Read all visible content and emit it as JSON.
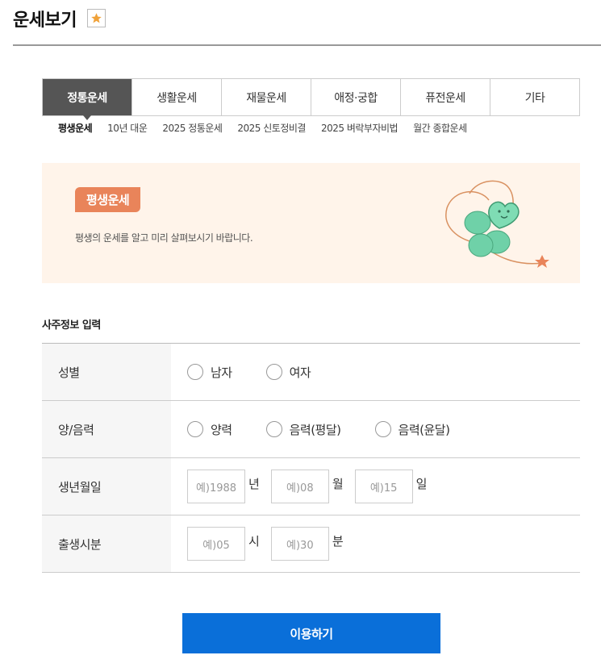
{
  "header": {
    "title": "운세보기",
    "favorite_icon": "star-icon",
    "star_color": "#f0a23a"
  },
  "tabs": [
    {
      "label": "정통운세",
      "active": true
    },
    {
      "label": "생활운세",
      "active": false
    },
    {
      "label": "재물운세",
      "active": false
    },
    {
      "label": "애정·궁합",
      "active": false
    },
    {
      "label": "퓨전운세",
      "active": false
    },
    {
      "label": "기타",
      "active": false
    }
  ],
  "subtabs": [
    {
      "label": "평생운세",
      "active": true
    },
    {
      "label": "10년 대운",
      "active": false
    },
    {
      "label": "2025 정통운세",
      "active": false
    },
    {
      "label": "2025 신토정비결",
      "active": false
    },
    {
      "label": "2025 벼락부자비법",
      "active": false
    },
    {
      "label": "월간 종합운세",
      "active": false
    }
  ],
  "banner": {
    "badge": "평생운세",
    "description": "평생의 운세를 알고 미리 살펴보시기 바랍니다.",
    "illustration": "clover-heart-icon",
    "badge_color": "#e9845a",
    "background_color": "#fff4ea"
  },
  "form": {
    "section_title": "사주정보 입력",
    "gender": {
      "label": "성별",
      "options": [
        "남자",
        "여자"
      ]
    },
    "calendar": {
      "label": "양/음력",
      "options": [
        "양력",
        "음력(평달)",
        "음력(윤달)"
      ]
    },
    "birth_date": {
      "label": "생년월일",
      "year_placeholder": "예)1988",
      "year_unit": "년",
      "month_placeholder": "예)08",
      "month_unit": "월",
      "day_placeholder": "예)15",
      "day_unit": "일"
    },
    "birth_time": {
      "label": "출생시분",
      "hour_placeholder": "예)05",
      "hour_unit": "시",
      "minute_placeholder": "예)30",
      "minute_unit": "분"
    }
  },
  "submit": {
    "label": "이용하기",
    "color": "#0a6fd9"
  }
}
